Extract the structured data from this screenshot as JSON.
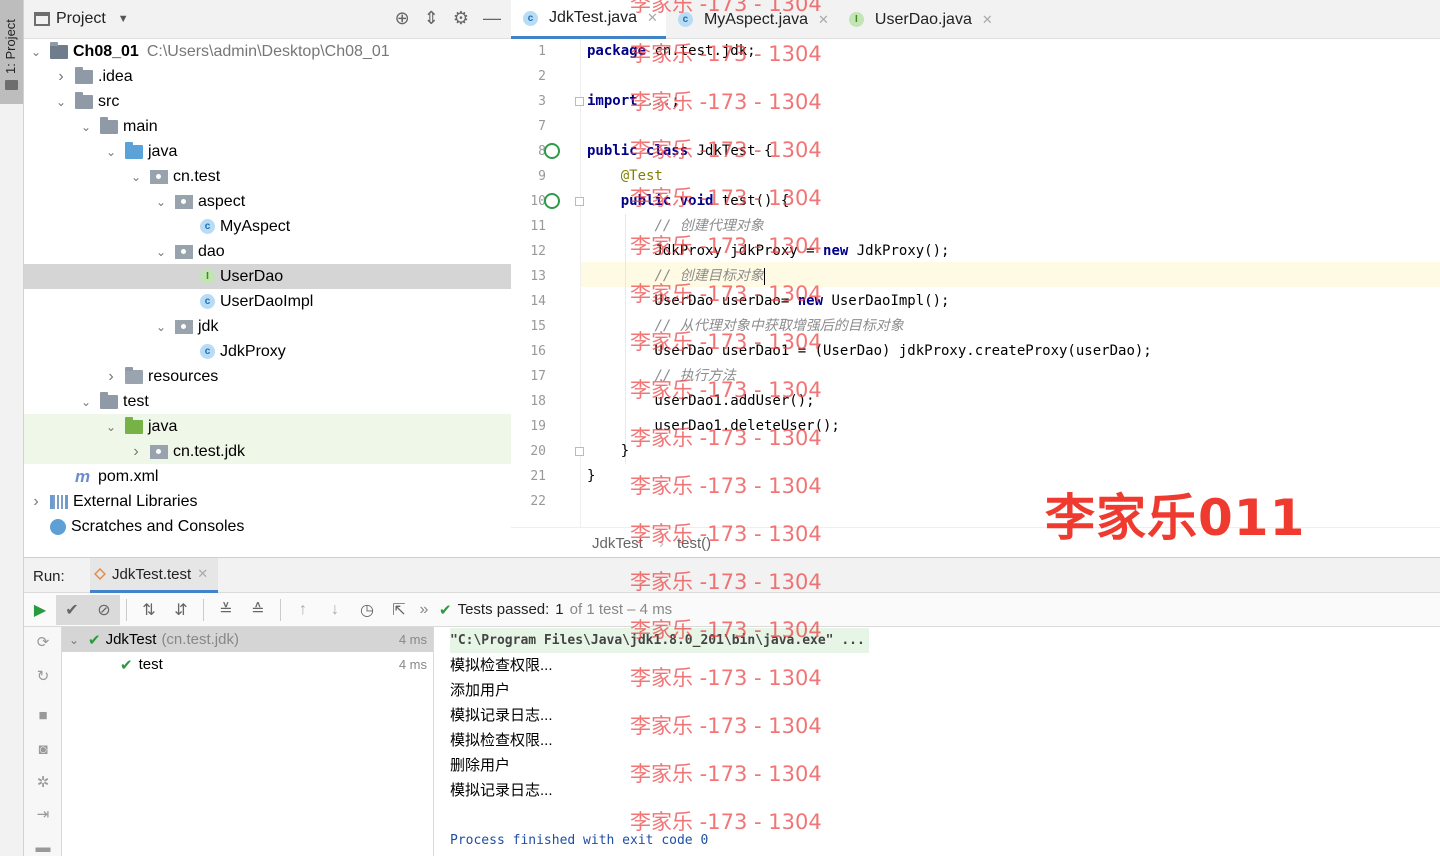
{
  "tool_strip": {
    "project_tab_label": "1: Project"
  },
  "project_pane": {
    "title": "Project",
    "tree": [
      {
        "label": "Ch08_01",
        "extra": "C:\\Users\\admin\\Desktop\\Ch08_01",
        "icon": "module-folder-icon",
        "depth": 0,
        "expanded": true
      },
      {
        "label": ".idea",
        "icon": "folder-icon",
        "depth": 1,
        "expanded": false
      },
      {
        "label": "src",
        "icon": "folder-icon",
        "depth": 1,
        "expanded": true
      },
      {
        "label": "main",
        "icon": "folder-icon",
        "depth": 2,
        "expanded": true
      },
      {
        "label": "java",
        "icon": "source-folder-icon",
        "depth": 3,
        "expanded": true
      },
      {
        "label": "cn.test",
        "icon": "package-icon",
        "depth": 4,
        "expanded": true
      },
      {
        "label": "aspect",
        "icon": "package-icon",
        "depth": 5,
        "expanded": true
      },
      {
        "label": "MyAspect",
        "icon": "class-icon",
        "depth": 6
      },
      {
        "label": "dao",
        "icon": "package-icon",
        "depth": 5,
        "expanded": true
      },
      {
        "label": "UserDao",
        "icon": "interface-icon",
        "depth": 6,
        "selected": true
      },
      {
        "label": "UserDaoImpl",
        "icon": "class-icon",
        "depth": 6
      },
      {
        "label": "jdk",
        "icon": "package-icon",
        "depth": 5,
        "expanded": true
      },
      {
        "label": "JdkProxy",
        "icon": "class-icon",
        "depth": 6
      },
      {
        "label": "resources",
        "icon": "resources-folder-icon",
        "depth": 3,
        "expanded": false
      },
      {
        "label": "test",
        "icon": "folder-icon",
        "depth": 2,
        "expanded": true
      },
      {
        "label": "java",
        "icon": "test-folder-icon",
        "depth": 3,
        "expanded": true
      },
      {
        "label": "cn.test.jdk",
        "icon": "package-icon",
        "depth": 4,
        "expanded": false
      },
      {
        "label": "pom.xml",
        "icon": "maven-icon",
        "depth": 1
      },
      {
        "label": "External Libraries",
        "icon": "libraries-icon",
        "depth": 0,
        "expanded": false
      },
      {
        "label": "Scratches and Consoles",
        "icon": "scratches-icon",
        "depth": 0
      }
    ]
  },
  "editor": {
    "tabs": [
      {
        "label": "JdkTest.java",
        "icon": "class-icon",
        "active": true
      },
      {
        "label": "MyAspect.java",
        "icon": "class-icon",
        "active": false
      },
      {
        "label": "UserDao.java",
        "icon": "interface-icon",
        "active": false
      }
    ],
    "lines": [
      {
        "n": "1",
        "text": "package cn.test.jdk;"
      },
      {
        "n": "2",
        "text": ""
      },
      {
        "n": "3",
        "text": "import ...;"
      },
      {
        "n": "7",
        "text": ""
      },
      {
        "n": "8",
        "text": "public class JdkTest {"
      },
      {
        "n": "9",
        "text": "    @Test"
      },
      {
        "n": "10",
        "text": "    public void test() {"
      },
      {
        "n": "11",
        "text": "        // 创建代理对象"
      },
      {
        "n": "12",
        "text": "        JdkProxy jdkProxy = new JdkProxy();"
      },
      {
        "n": "13",
        "text": "        // 创建目标对象"
      },
      {
        "n": "14",
        "text": "        UserDao userDao= new UserDaoImpl();"
      },
      {
        "n": "15",
        "text": "        // 从代理对象中获取增强后的目标对象"
      },
      {
        "n": "16",
        "text": "        UserDao userDao1 = (UserDao) jdkProxy.createProxy(userDao);"
      },
      {
        "n": "17",
        "text": "        // 执行方法"
      },
      {
        "n": "18",
        "text": "        userDao1.addUser();"
      },
      {
        "n": "19",
        "text": "        userDao1.deleteUser();"
      },
      {
        "n": "20",
        "text": "    }"
      },
      {
        "n": "21",
        "text": "}"
      },
      {
        "n": "22",
        "text": ""
      }
    ],
    "breadcrumb": [
      "JdkTest",
      "test()"
    ]
  },
  "run": {
    "label": "Run:",
    "tab": "JdkTest.test",
    "summary": {
      "status": "Tests passed:",
      "count": "1",
      "of_text": "of 1 test – 4 ms"
    },
    "tests": [
      {
        "name": "JdkTest",
        "qualifier": "(cn.test.jdk)",
        "time": "4 ms"
      },
      {
        "name": "test",
        "qualifier": "",
        "time": "4 ms"
      }
    ],
    "console": [
      "\"C:\\Program Files\\Java\\jdk1.8.0_201\\bin\\java.exe\" ...",
      "模拟检查权限...",
      "添加用户",
      "模拟记录日志...",
      "模拟检查权限...",
      "删除用户",
      "模拟记录日志...",
      "",
      "Process finished with exit code 0"
    ]
  },
  "watermark": {
    "repeat_text": "李家乐 -173 - 1304",
    "signature": "李家乐011"
  },
  "colors": {
    "accent": "#4083c9",
    "pass_green": "#2a9a3f",
    "watermark_red": "#ee3a2f"
  }
}
